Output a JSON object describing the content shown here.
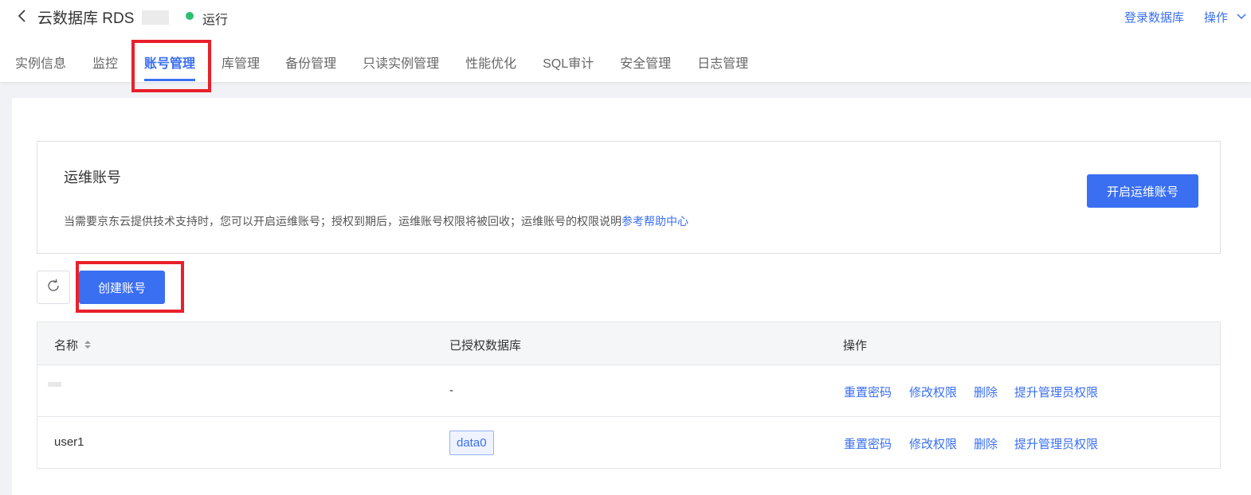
{
  "header": {
    "title": "云数据库 RDS",
    "status": "运行",
    "login_link": "登录数据库",
    "operate_link": "操作"
  },
  "tabs": [
    {
      "label": "实例信息"
    },
    {
      "label": "监控"
    },
    {
      "label": "账号管理"
    },
    {
      "label": "库管理"
    },
    {
      "label": "备份管理"
    },
    {
      "label": "只读实例管理"
    },
    {
      "label": "性能优化"
    },
    {
      "label": "SQL审计"
    },
    {
      "label": "安全管理"
    },
    {
      "label": "日志管理"
    }
  ],
  "active_tab": "账号管理",
  "ops_account": {
    "title": "运维账号",
    "description": "当需要京东云提供技术支持时，您可以开启运维账号；授权到期后，运维账号权限将被回收；运维账号的权限说明",
    "help_link": "参考帮助中心",
    "enable_button": "开启运维账号"
  },
  "toolbar": {
    "create_button": "创建账号"
  },
  "table": {
    "headers": {
      "name": "名称",
      "databases": "已授权数据库",
      "actions": "操作"
    },
    "rows": [
      {
        "name": "",
        "database": "-",
        "database_is_tag": false
      },
      {
        "name": "user1",
        "database": "data0",
        "database_is_tag": true
      }
    ],
    "action_labels": {
      "reset_password": "重置密码",
      "modify_permissions": "修改权限",
      "delete": "删除",
      "promote_admin": "提升管理员权限"
    }
  },
  "colors": {
    "accent": "#3a6ff2",
    "status_running": "#2bbf70",
    "highlight": "#e8202a"
  }
}
